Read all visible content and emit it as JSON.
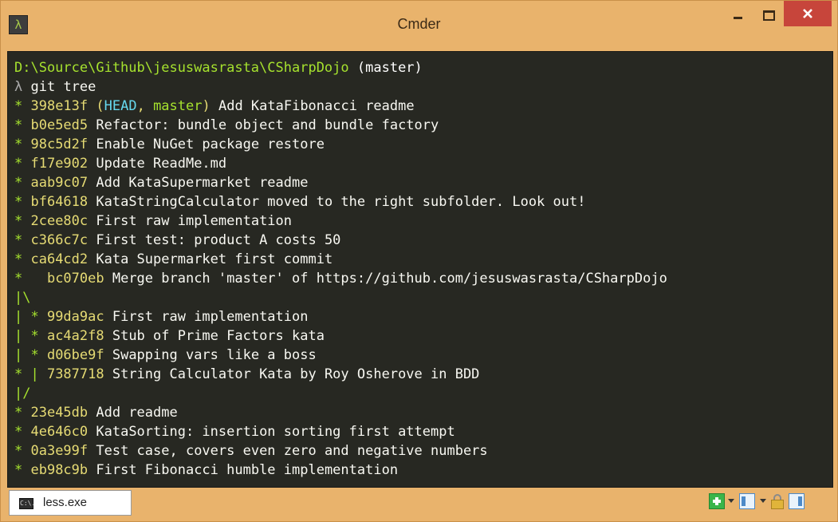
{
  "window": {
    "title": "Cmder",
    "icon_glyph": "λ"
  },
  "console": {
    "prompt_path": "D:\\Source\\Github\\jesuswasrasta\\CSharpDojo",
    "prompt_branch": "(master)",
    "prompt_symbol": "λ",
    "command": "git tree",
    "head_label": "HEAD",
    "master_label": "master",
    "lines": [
      {
        "graph": "* ",
        "hash": "398e13f",
        "refs": true,
        "msg": " Add KataFibonacci readme"
      },
      {
        "graph": "* ",
        "hash": "b0e5ed5",
        "msg": " Refactor: bundle object and bundle factory"
      },
      {
        "graph": "* ",
        "hash": "98c5d2f",
        "msg": " Enable NuGet package restore"
      },
      {
        "graph": "* ",
        "hash": "f17e902",
        "msg": " Update ReadMe.md"
      },
      {
        "graph": "* ",
        "hash": "aab9c07",
        "msg": " Add KataSupermarket readme"
      },
      {
        "graph": "* ",
        "hash": "bf64618",
        "msg": " KataStringCalculator moved to the right subfolder. Look out!"
      },
      {
        "graph": "* ",
        "hash": "2cee80c",
        "msg": " First raw implementation"
      },
      {
        "graph": "* ",
        "hash": "c366c7c",
        "msg": " First test: product A costs 50"
      },
      {
        "graph": "* ",
        "hash": "ca64cd2",
        "msg": " Kata Supermarket first commit"
      },
      {
        "graph": "*   ",
        "hash": "bc070eb",
        "msg": " Merge branch 'master' of https://github.com/jesuswasrasta/CSharpDojo"
      },
      {
        "graph": "|\\",
        "hash": "",
        "msg": ""
      },
      {
        "graph": "| * ",
        "hash": "99da9ac",
        "msg": " First raw implementation"
      },
      {
        "graph": "| * ",
        "hash": "ac4a2f8",
        "msg": " Stub of Prime Factors kata"
      },
      {
        "graph": "| * ",
        "hash": "d06be9f",
        "msg": " Swapping vars like a boss"
      },
      {
        "graph": "* | ",
        "hash": "7387718",
        "msg": " String Calculator Kata by Roy Osherove in BDD"
      },
      {
        "graph": "|/",
        "hash": "",
        "msg": ""
      },
      {
        "graph": "* ",
        "hash": "23e45db",
        "msg": " Add readme"
      },
      {
        "graph": "* ",
        "hash": "4e646c0",
        "msg": " KataSorting: insertion sorting first attempt"
      },
      {
        "graph": "* ",
        "hash": "0a3e99f",
        "msg": " Test case, covers even zero and negative numbers"
      },
      {
        "graph": "* ",
        "hash": "eb98c9b",
        "msg": " First Fibonacci humble implementation"
      }
    ]
  },
  "statusbar": {
    "tab_icon_text": "C:\\.",
    "tab_label": "less.exe",
    "icons": [
      "new-console-icon",
      "split-icon",
      "lock-icon",
      "tile-icon"
    ]
  },
  "colors": {
    "frame": "#e9b36c",
    "console_bg": "#272822",
    "close_button": "#c7453b",
    "graph_green": "#a6e22e",
    "hash_yellow": "#e6db74",
    "head_blue": "#66d9ef"
  }
}
